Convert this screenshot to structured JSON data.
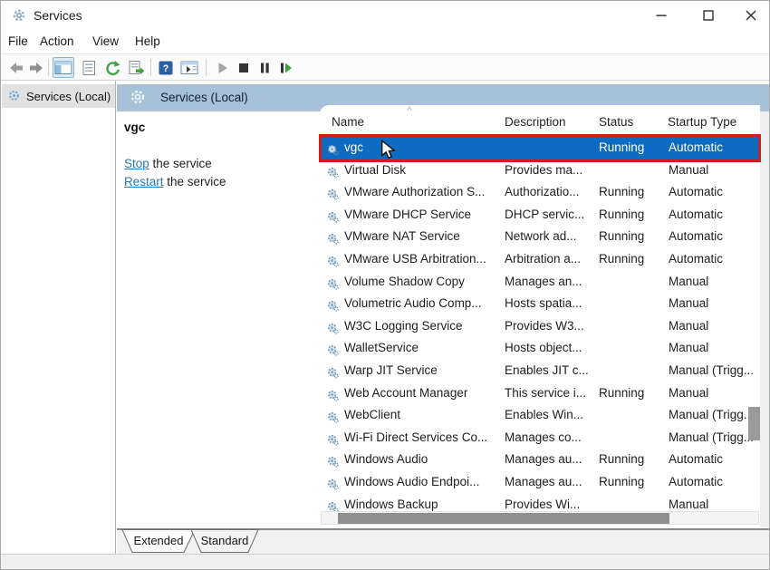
{
  "window": {
    "title": "Services",
    "control_icons": [
      "minimize-icon",
      "maximize-icon",
      "close-icon"
    ]
  },
  "menu": {
    "items": [
      "File",
      "Action",
      "View",
      "Help"
    ]
  },
  "toolbar": {
    "icons": [
      "back-arrow-icon",
      "forward-arrow-icon",
      "show-console-tree-icon",
      "properties-icon",
      "refresh-icon",
      "export-list-icon",
      "help-icon",
      "show-action-pane-icon",
      "start-service-icon",
      "stop-service-icon",
      "pause-service-icon",
      "restart-service-icon"
    ]
  },
  "sidebar": {
    "root_item": "Services (Local)"
  },
  "main": {
    "header": "Services (Local)",
    "task_pane": {
      "service_name": "vgc",
      "links": [
        {
          "link_text": "Stop",
          "suffix": " the service"
        },
        {
          "link_text": "Restart",
          "suffix": " the service"
        }
      ]
    },
    "table": {
      "columns": [
        "Name",
        "Description",
        "Status",
        "Startup Type"
      ],
      "sort_indicator": "^",
      "rows": [
        {
          "name": "vgc",
          "description": "",
          "status": "Running",
          "startup": "Automatic",
          "selected": true
        },
        {
          "name": "Virtual Disk",
          "description": "Provides ma...",
          "status": "",
          "startup": "Manual",
          "selected": false
        },
        {
          "name": "VMware Authorization S...",
          "description": "Authorizatio...",
          "status": "Running",
          "startup": "Automatic",
          "selected": false
        },
        {
          "name": "VMware DHCP Service",
          "description": "DHCP servic...",
          "status": "Running",
          "startup": "Automatic",
          "selected": false
        },
        {
          "name": "VMware NAT Service",
          "description": "Network ad...",
          "status": "Running",
          "startup": "Automatic",
          "selected": false
        },
        {
          "name": "VMware USB Arbitration...",
          "description": "Arbitration a...",
          "status": "Running",
          "startup": "Automatic",
          "selected": false
        },
        {
          "name": "Volume Shadow Copy",
          "description": "Manages an...",
          "status": "",
          "startup": "Manual",
          "selected": false
        },
        {
          "name": "Volumetric Audio Comp...",
          "description": "Hosts spatia...",
          "status": "",
          "startup": "Manual",
          "selected": false
        },
        {
          "name": "W3C Logging Service",
          "description": "Provides W3...",
          "status": "",
          "startup": "Manual",
          "selected": false
        },
        {
          "name": "WalletService",
          "description": "Hosts object...",
          "status": "",
          "startup": "Manual",
          "selected": false
        },
        {
          "name": "Warp JIT Service",
          "description": "Enables JIT c...",
          "status": "",
          "startup": "Manual (Trigg...",
          "selected": false
        },
        {
          "name": "Web Account Manager",
          "description": "This service i...",
          "status": "Running",
          "startup": "Manual",
          "selected": false
        },
        {
          "name": "WebClient",
          "description": "Enables Win...",
          "status": "",
          "startup": "Manual (Trigg...",
          "selected": false
        },
        {
          "name": "Wi-Fi Direct Services Co...",
          "description": "Manages co...",
          "status": "",
          "startup": "Manual (Trigg...",
          "selected": false
        },
        {
          "name": "Windows Audio",
          "description": "Manages au...",
          "status": "Running",
          "startup": "Automatic",
          "selected": false
        },
        {
          "name": "Windows Audio Endpoi...",
          "description": "Manages au...",
          "status": "Running",
          "startup": "Automatic",
          "selected": false
        },
        {
          "name": "Windows Backup",
          "description": "Provides Wi...",
          "status": "",
          "startup": "Manual",
          "selected": false
        }
      ]
    },
    "tabs": [
      {
        "label": "Extended",
        "active": true
      },
      {
        "label": "Standard",
        "active": false
      }
    ]
  },
  "colors": {
    "selection_blue": "#0d6cc2",
    "annotation_red": "#cb1f1f",
    "header_band_blue": "#a6c1d8",
    "link_blue": "#2e77ae"
  }
}
